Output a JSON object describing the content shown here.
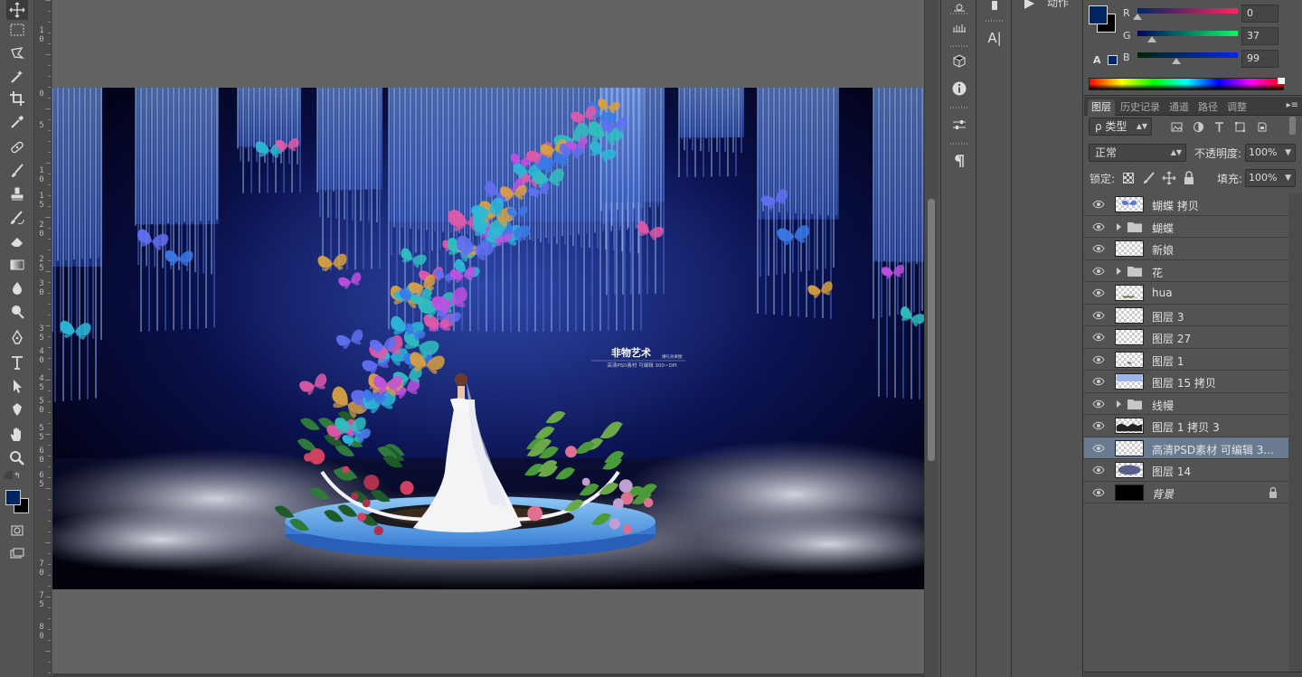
{
  "ruler_left": {
    "labels": [
      "1\n0",
      "0",
      "5",
      "1\n0",
      "1\n5",
      "2\n0",
      "2\n5",
      "3\n0",
      "3\n5",
      "4\n0",
      "4\n5",
      "5\n0",
      "5\n5",
      "6\n0",
      "6\n5",
      "7\n0",
      "7\n5",
      "8\n0"
    ]
  },
  "artwork": {
    "logo_title": "非物艺术",
    "logo_small": "婚礼效果图",
    "logo_sub": "高清PSD素材 可编辑 300~DPI"
  },
  "panel_icons2": {
    "char_icon_label": "A|"
  },
  "actions": {
    "label": "动作"
  },
  "color": {
    "foreground_hex": "#002563",
    "background_hex": "#000000",
    "r_label": "R",
    "g_label": "G",
    "b_label": "B",
    "r_value": "0",
    "g_value": "37",
    "b_value": "99",
    "r_fraction": 0,
    "g_fraction": 0.145,
    "b_fraction": 0.388
  },
  "layers_panel": {
    "tabs": [
      {
        "label": "图层",
        "active": true
      },
      {
        "label": "历史记录",
        "active": false
      },
      {
        "label": "通道",
        "active": false
      },
      {
        "label": "路径",
        "active": false
      },
      {
        "label": "调整",
        "active": false
      }
    ],
    "filter_kind": "ρ 类型",
    "blend_mode": "正常",
    "opacity_label": "不透明度:",
    "opacity_value": "100%",
    "lock_label": "锁定:",
    "fill_label": "填充:",
    "fill_value": "100%",
    "layers": [
      {
        "name": "蝴蝶 拷贝",
        "type": "layer",
        "thumb": "butterfly"
      },
      {
        "name": "蝴蝶",
        "type": "group"
      },
      {
        "name": "新娘",
        "type": "layer",
        "thumb": "blank"
      },
      {
        "name": "花",
        "type": "group"
      },
      {
        "name": "hua",
        "type": "layer",
        "thumb": "flower"
      },
      {
        "name": "图层 3",
        "type": "layer",
        "thumb": "blank"
      },
      {
        "name": "图层 27",
        "type": "layer",
        "thumb": "blank"
      },
      {
        "name": "图层 1",
        "type": "layer",
        "thumb": "dot"
      },
      {
        "name": "图层 15 拷贝",
        "type": "layer",
        "thumb": "curtain"
      },
      {
        "name": "线幔",
        "type": "group"
      },
      {
        "name": "图层 1 拷贝 3",
        "type": "layer",
        "thumb": "silhouette"
      },
      {
        "name": "高清PSD素材 可编辑 3...",
        "type": "layer",
        "thumb": "blank",
        "selected": true
      },
      {
        "name": "图层 14",
        "type": "layer",
        "thumb": "smoke"
      },
      {
        "name": "背景",
        "type": "background",
        "thumb": "black",
        "italic": true,
        "locked": true
      }
    ]
  }
}
